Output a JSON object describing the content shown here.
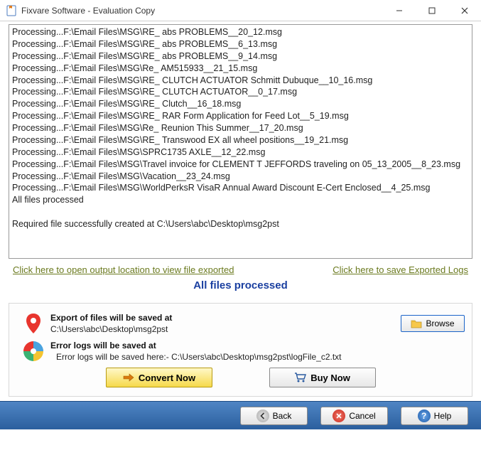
{
  "window": {
    "title": "Fixvare Software - Evaluation Copy"
  },
  "log": {
    "lines": [
      "Processing...F:\\Email Files\\MSG\\RE_ abs PROBLEMS__20_12.msg",
      "Processing...F:\\Email Files\\MSG\\RE_ abs PROBLEMS__6_13.msg",
      "Processing...F:\\Email Files\\MSG\\RE_ abs PROBLEMS__9_14.msg",
      "Processing...F:\\Email Files\\MSG\\Re_ AM515933__21_15.msg",
      "Processing...F:\\Email Files\\MSG\\RE_ CLUTCH ACTUATOR Schmitt Dubuque__10_16.msg",
      "Processing...F:\\Email Files\\MSG\\RE_ CLUTCH ACTUATOR__0_17.msg",
      "Processing...F:\\Email Files\\MSG\\RE_ Clutch__16_18.msg",
      "Processing...F:\\Email Files\\MSG\\RE_ RAR Form Application for Feed Lot__5_19.msg",
      "Processing...F:\\Email Files\\MSG\\Re_ Reunion This Summer__17_20.msg",
      "Processing...F:\\Email Files\\MSG\\RE_ Transwood EX all wheel positions__19_21.msg",
      "Processing...F:\\Email Files\\MSG\\SPRC1735 AXLE__12_22.msg",
      "Processing...F:\\Email Files\\MSG\\Travel invoice for CLEMENT T JEFFORDS traveling on 05_13_2005__8_23.msg",
      "Processing...F:\\Email Files\\MSG\\Vacation__23_24.msg",
      "Processing...F:\\Email Files\\MSG\\WorldPerksR VisaR Annual Award Discount E-Cert Enclosed__4_25.msg",
      "All files processed",
      "",
      "Required file successfully created at C:\\Users\\abc\\Desktop\\msg2pst"
    ]
  },
  "links": {
    "open_output": "Click here to open output location to view file exported",
    "save_logs": "Click here to save Exported Logs"
  },
  "status": "All files processed",
  "export": {
    "label": "Export of files will be saved at",
    "path": "C:\\Users\\abc\\Desktop\\msg2pst",
    "browse": "Browse"
  },
  "errors": {
    "label": "Error logs will be saved at",
    "path": "Error logs will be saved here:- C:\\Users\\abc\\Desktop\\msg2pst\\logFile_c2.txt"
  },
  "actions": {
    "convert": "Convert Now",
    "buy": "Buy Now"
  },
  "footer": {
    "back": "Back",
    "cancel": "Cancel",
    "help": "Help"
  }
}
